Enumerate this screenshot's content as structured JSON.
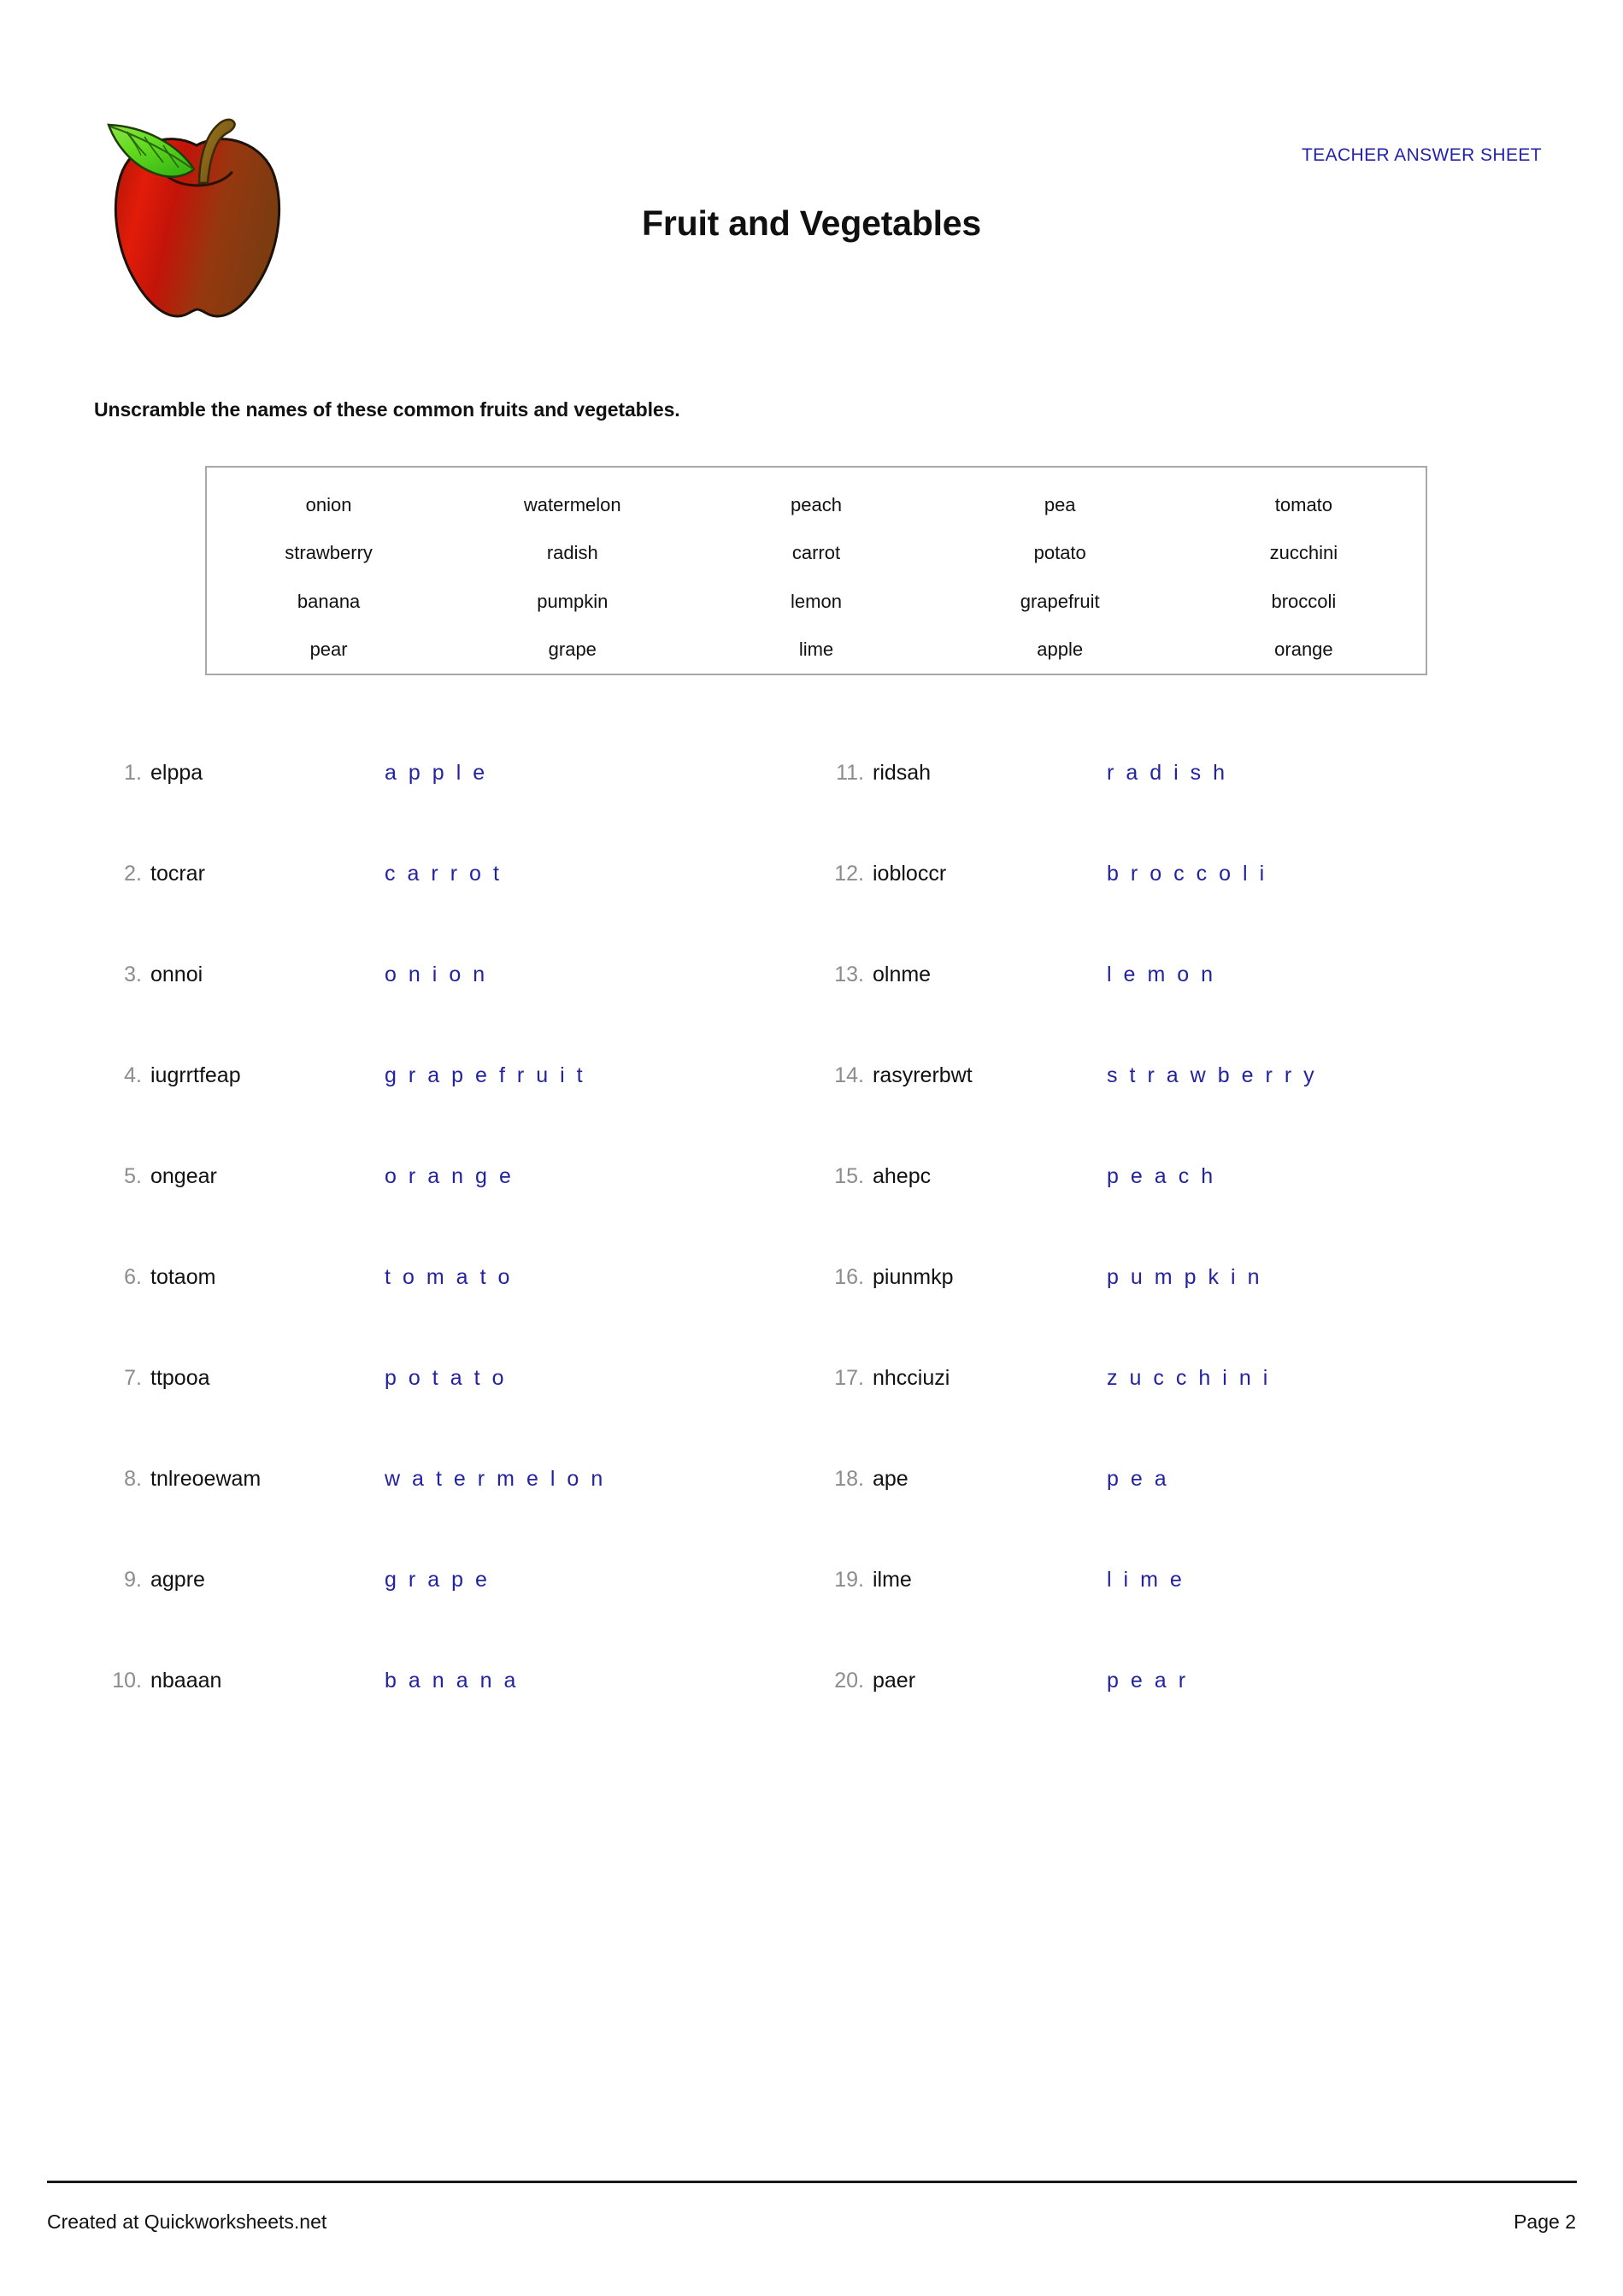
{
  "header": {
    "title": "Fruit and Vegetables",
    "answer_sheet_tag": "TEACHER ANSWER SHEET",
    "icon_name": "apple-icon",
    "colors": {
      "answer_blue": "#2323a0",
      "tag_blue": "#2323a8",
      "number_gray": "#8c8c8c",
      "wordbank_border": "#a8a8a8",
      "apple_red": "#cc1111",
      "apple_dark": "#8a3a10",
      "leaf_green": "#55dd22",
      "stem_brown": "#8a6a1e"
    }
  },
  "instructions": "Unscramble the names of these common fruits and vegetables.",
  "wordbank": {
    "words": [
      "onion",
      "watermelon",
      "peach",
      "pea",
      "tomato",
      "strawberry",
      "radish",
      "carrot",
      "potato",
      "zucchini",
      "banana",
      "pumpkin",
      "lemon",
      "grapefruit",
      "broccoli",
      "pear",
      "grape",
      "lime",
      "apple",
      "orange"
    ]
  },
  "items_left": [
    {
      "num": "1.",
      "scramble": "elppa",
      "answer": "apple"
    },
    {
      "num": "2.",
      "scramble": "tocrar",
      "answer": "carrot"
    },
    {
      "num": "3.",
      "scramble": "onnoi",
      "answer": "onion"
    },
    {
      "num": "4.",
      "scramble": "iugrrtfeap",
      "answer": "grapefruit"
    },
    {
      "num": "5.",
      "scramble": "ongear",
      "answer": "orange"
    },
    {
      "num": "6.",
      "scramble": "totaom",
      "answer": "tomato"
    },
    {
      "num": "7.",
      "scramble": "ttpooa",
      "answer": "potato"
    },
    {
      "num": "8.",
      "scramble": "tnlreoewam",
      "answer": "watermelon"
    },
    {
      "num": "9.",
      "scramble": "agpre",
      "answer": "grape"
    },
    {
      "num": "10.",
      "scramble": "nbaaan",
      "answer": "banana"
    }
  ],
  "items_right": [
    {
      "num": "11.",
      "scramble": "ridsah",
      "answer": "radish"
    },
    {
      "num": "12.",
      "scramble": "iobloccr",
      "answer": "broccoli"
    },
    {
      "num": "13.",
      "scramble": "olnme",
      "answer": "lemon"
    },
    {
      "num": "14.",
      "scramble": "rasyrerbwt",
      "answer": "strawberry"
    },
    {
      "num": "15.",
      "scramble": "ahepc",
      "answer": "peach"
    },
    {
      "num": "16.",
      "scramble": "piunmkp",
      "answer": "pumpkin"
    },
    {
      "num": "17.",
      "scramble": "nhcciuzi",
      "answer": "zucchini"
    },
    {
      "num": "18.",
      "scramble": "ape",
      "answer": "pea"
    },
    {
      "num": "19.",
      "scramble": "ilme",
      "answer": "lime"
    },
    {
      "num": "20.",
      "scramble": "paer",
      "answer": "pear"
    }
  ],
  "footer": {
    "created_at": "Created at Quickworksheets.net",
    "page": "Page 2"
  }
}
